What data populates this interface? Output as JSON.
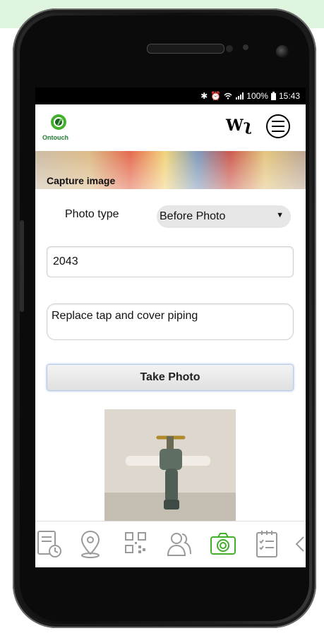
{
  "status_bar": {
    "battery": "100%",
    "time": "15:43"
  },
  "app_bar": {
    "logo_text": "Ontouch",
    "brand_mark": "Wʅ"
  },
  "header": {
    "title": "Capture image"
  },
  "form": {
    "photo_type_label": "Photo type",
    "photo_type_value": "Before Photo",
    "reference_value": "2043",
    "description_value": "Replace tap and cover piping",
    "take_photo_label": "Take Photo"
  },
  "bottom_nav": {
    "items": [
      "document-clock-icon",
      "location-pin-icon",
      "qr-code-icon",
      "users-icon",
      "camera-icon",
      "checklist-icon",
      "chevron-left-icon"
    ],
    "active_color": "#43b02a",
    "inactive_color": "#9a9a9a"
  },
  "colors": {
    "banner": "#dff5df",
    "accent_green": "#43b02a"
  }
}
